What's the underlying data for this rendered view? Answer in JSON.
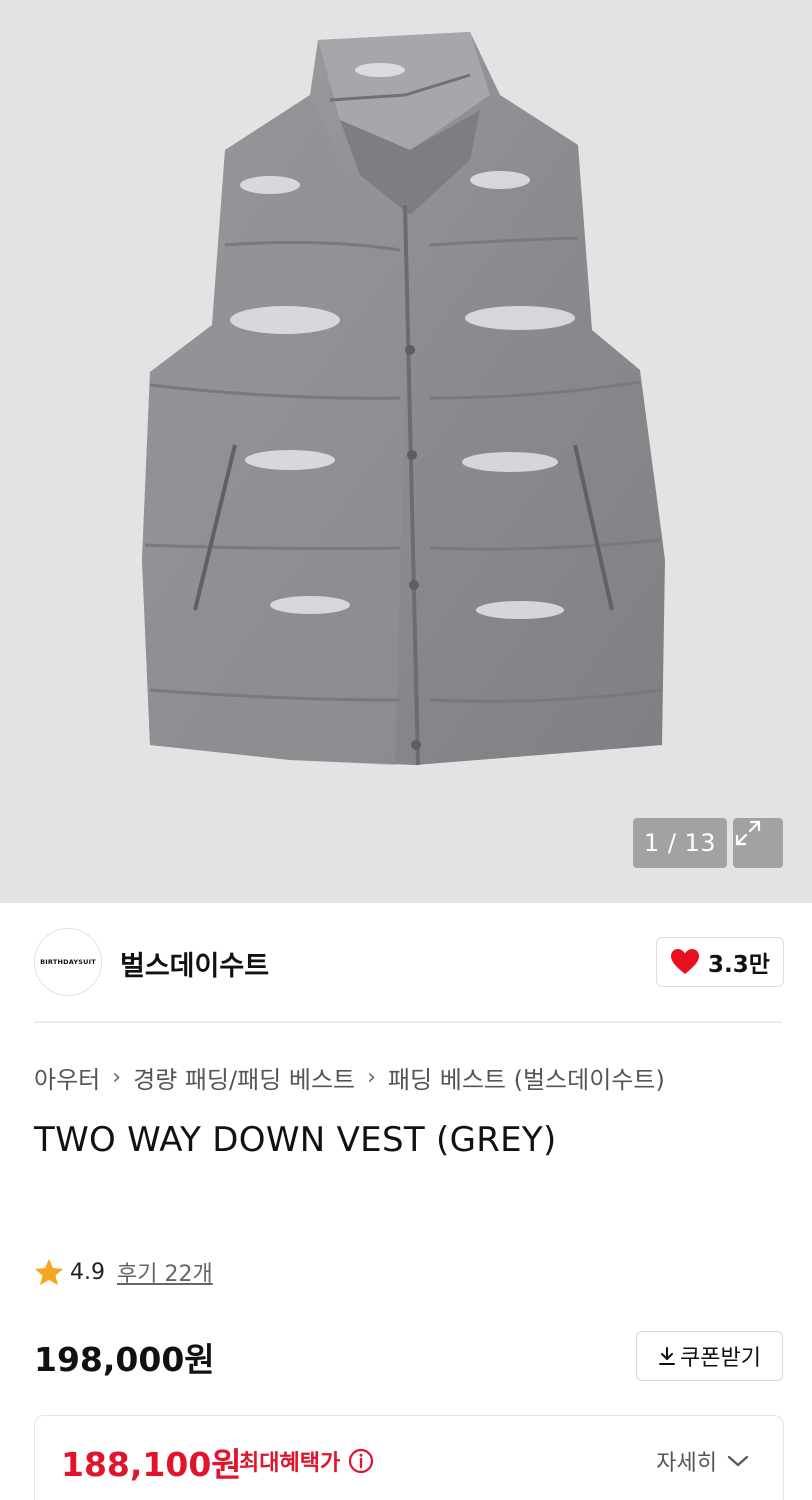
{
  "gallery": {
    "counter": "1 / 13",
    "image_subject": "grey glossy puffer down vest"
  },
  "brand": {
    "logo_text": "BIRTHDAYSUIT",
    "name": "벌스데이수트",
    "like_count": "3.3만"
  },
  "breadcrumb": [
    "아우터",
    "경량 패딩/패딩 베스트",
    "패딩 베스트 (벌스데이수트)"
  ],
  "product": {
    "title": "TWO WAY DOWN VEST (GREY)",
    "rating": "4.9",
    "review_label": "후기 22개",
    "price": "198,000원",
    "coupon_label": "쿠폰받기"
  },
  "benefit": {
    "price": "188,100원",
    "label": "최대혜택가",
    "details_label": "자세히"
  },
  "colors": {
    "accent_red": "#e0142b",
    "star": "#f5a623",
    "heart": "#e8101f"
  },
  "icons": [
    "expand-icon",
    "heart-icon",
    "chevron-right-icon",
    "star-icon",
    "download-icon",
    "info-icon",
    "chevron-down-icon"
  ]
}
